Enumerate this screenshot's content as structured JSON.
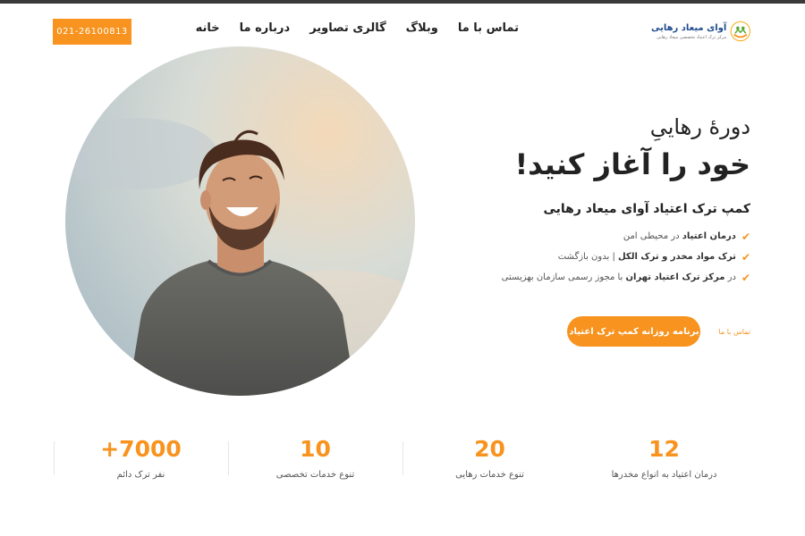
{
  "header": {
    "logo_title": "آوای میعاد رهایی",
    "logo_subtitle": "مرکز ترک اعتیاد تخصصی میعاد رهایی",
    "nav": [
      "خانه",
      "درباره ما",
      "گالری تصاویر",
      "وبلاگ",
      "تماس با ما"
    ],
    "phone": "021-26100813"
  },
  "hero": {
    "line1": "دورهٔ رهاییِ",
    "line2": "خود را آغاز کنید!",
    "subtitle": "کمپ ترک اعتیاد آوای میعاد رهایی",
    "features": [
      {
        "bold": "درمان اعتیاد",
        "rest": " در محیطی امن"
      },
      {
        "bold": "ترک مواد مخدر و ترک الکل",
        "rest": " | بدون بازگشت"
      },
      {
        "pre": "در ",
        "bold": "مرکز ترک اعتیاد تهران",
        "rest": " با مجوز رسمی سازمان بهزیستی"
      }
    ],
    "cta_button": "برنامه روزانه کمپ ترک اعتیاد",
    "cta_link": "تماس با ما"
  },
  "stats": [
    {
      "value": "+7000",
      "label": "نفر ترک دائم"
    },
    {
      "value": "10",
      "label": "تنوع خدمات تخصصی"
    },
    {
      "value": "20",
      "label": "تنوع خدمات رهایی"
    },
    {
      "value": "12",
      "label": "درمان اعتیاد به انواع مخدرها"
    }
  ],
  "colors": {
    "accent": "#f7931e",
    "brand": "#1f4b8e"
  }
}
